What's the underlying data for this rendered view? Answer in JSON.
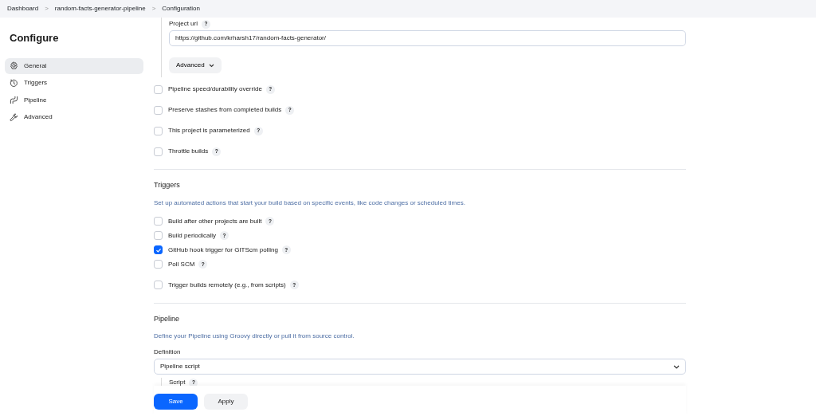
{
  "breadcrumbs": [
    {
      "label": "Dashboard",
      "separator": ">"
    },
    {
      "label": "random-facts-generator-pipeline",
      "separator": ">"
    },
    {
      "label": "Configuration"
    }
  ],
  "sidebar": {
    "title": "Configure",
    "items": [
      {
        "label": "General",
        "selected": true
      },
      {
        "label": "Triggers",
        "selected": false
      },
      {
        "label": "Pipeline",
        "selected": false
      },
      {
        "label": "Advanced",
        "selected": false
      }
    ]
  },
  "project_url": {
    "label": "Project url",
    "help": "?",
    "value": "https://github.com/krharsh17/random-facts-generator/",
    "advanced_button": "Advanced"
  },
  "general_options": [
    {
      "label": "Pipeline speed/durability override",
      "help": "?",
      "checked": false
    },
    {
      "label": "Preserve stashes from completed builds",
      "help": "?",
      "checked": false
    },
    {
      "label": "This project is parameterized",
      "help": "?",
      "checked": false
    },
    {
      "label": "Throttle builds",
      "help": "?",
      "checked": false
    }
  ],
  "triggers": {
    "title": "Triggers",
    "description": "Set up automated actions that start your build based on specific events, like code changes or scheduled times.",
    "options": [
      {
        "label": "Build after other projects are built",
        "help": "?",
        "checked": false
      },
      {
        "label": "Build periodically",
        "help": "?",
        "checked": false
      },
      {
        "label": "GitHub hook trigger for GITScm polling",
        "help": "?",
        "checked": true
      },
      {
        "label": "Poll SCM",
        "help": "?",
        "checked": false
      },
      {
        "label": "Trigger builds remotely (e.g., from scripts)",
        "help": "?",
        "checked": false
      }
    ]
  },
  "pipeline": {
    "title": "Pipeline",
    "description": "Define your Pipeline using Groovy directly or pull it from source control.",
    "definition_label": "Definition",
    "definition_value": "Pipeline script",
    "script_label": "Script",
    "script_help": "?"
  },
  "buttons": [
    {
      "label": "Save",
      "kind": "primary"
    },
    {
      "label": "Apply",
      "kind": "secondary"
    }
  ]
}
